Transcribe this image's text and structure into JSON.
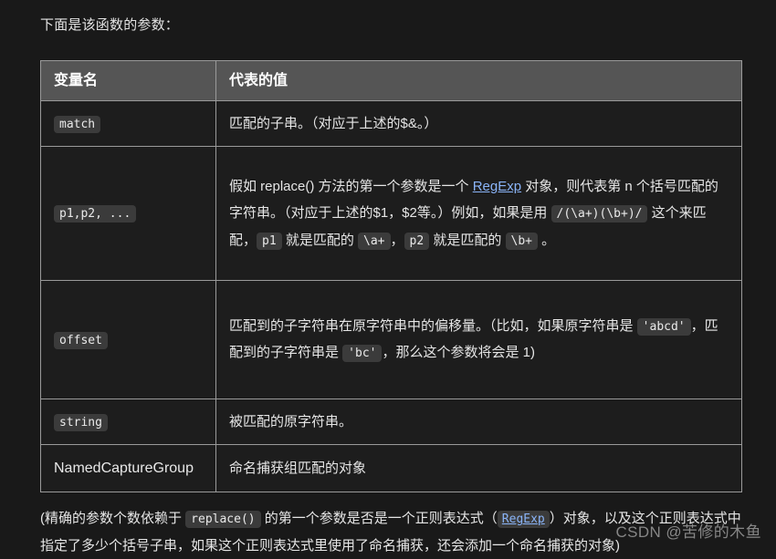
{
  "page": {
    "background_color": "#191919",
    "text_color": "#e6e6e6",
    "link_color": "#8ab4f8",
    "code_background": "#3b3b3b",
    "table_header_background": "#555555",
    "table_border_color": "#9a9a9a"
  },
  "intro": "下面是该函数的参数：",
  "table": {
    "headers": [
      "变量名",
      "代表的值"
    ],
    "rows": [
      {
        "name": "match",
        "name_is_code": true,
        "value_parts": [
          {
            "type": "text",
            "text": "匹配的子串。（对应于上述的$&。）"
          }
        ]
      },
      {
        "name": "p1,p2, ...",
        "name_is_code": true,
        "value_parts": [
          {
            "type": "text",
            "text": "假如 replace() 方法的第一个参数是一个 "
          },
          {
            "type": "link",
            "text": "RegExp"
          },
          {
            "type": "text",
            "text": " 对象，则代表第 n 个括号匹配的字符串。（对应于上述的$1，$2等。）例如，如果是用 "
          },
          {
            "type": "code",
            "text": "/(\\a+)(\\b+)/"
          },
          {
            "type": "text",
            "text": " 这个来匹配，"
          },
          {
            "type": "code",
            "text": "p1"
          },
          {
            "type": "text",
            "text": " 就是匹配的 "
          },
          {
            "type": "code",
            "text": "\\a+"
          },
          {
            "type": "text",
            "text": "，"
          },
          {
            "type": "code",
            "text": "p2"
          },
          {
            "type": "text",
            "text": " 就是匹配的 "
          },
          {
            "type": "code",
            "text": "\\b+"
          },
          {
            "type": "text",
            "text": " 。"
          }
        ]
      },
      {
        "name": "offset",
        "name_is_code": true,
        "value_parts": [
          {
            "type": "text",
            "text": "匹配到的子字符串在原字符串中的偏移量。（比如，如果原字符串是 "
          },
          {
            "type": "code",
            "text": "'abcd'"
          },
          {
            "type": "text",
            "text": "，匹配到的子字符串是 "
          },
          {
            "type": "code",
            "text": "'bc'"
          },
          {
            "type": "text",
            "text": "，那么这个参数将会是 1)"
          }
        ]
      },
      {
        "name": "string",
        "name_is_code": true,
        "value_parts": [
          {
            "type": "text",
            "text": "被匹配的原字符串。"
          }
        ]
      },
      {
        "name": "NamedCaptureGroup",
        "name_is_code": false,
        "value_parts": [
          {
            "type": "text",
            "text": "命名捕获组匹配的对象"
          }
        ]
      }
    ]
  },
  "footnote_parts": [
    {
      "type": "text",
      "text": "(精确的参数个数依赖于 "
    },
    {
      "type": "code",
      "text": "replace()"
    },
    {
      "type": "text",
      "text": " 的第一个参数是否是一个正则表达式（"
    },
    {
      "type": "codelink",
      "text": "RegExp"
    },
    {
      "type": "text",
      "text": "）对象，以及这个正则表达式中指定了多少个括号子串，如果这个正则表达式里使用了命名捕获，还会添加一个命名捕获的对象)"
    }
  ],
  "watermark": "CSDN @苦修的木鱼"
}
